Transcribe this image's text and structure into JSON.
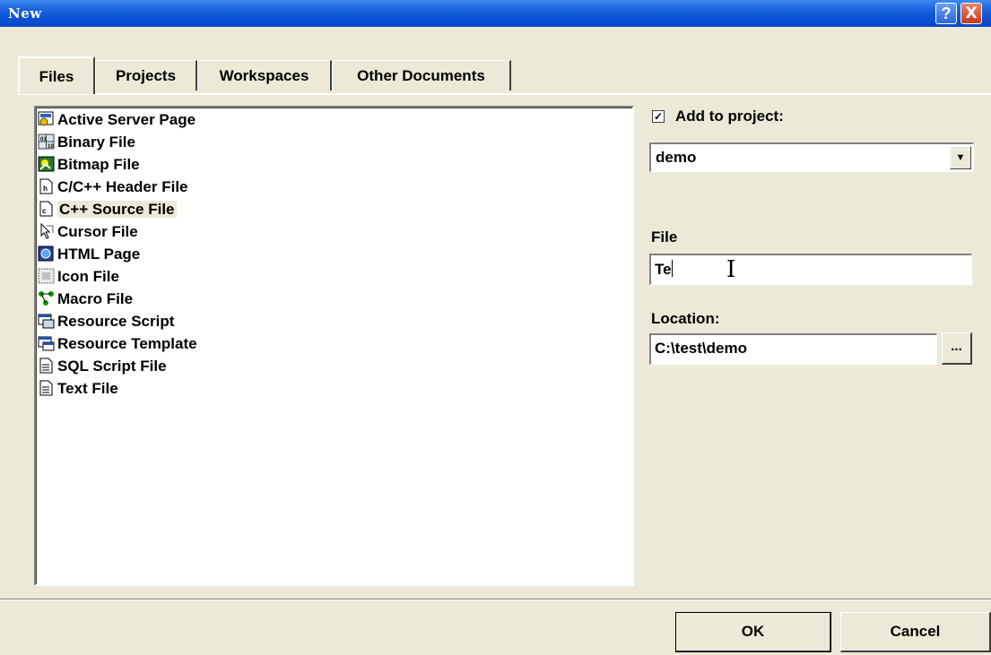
{
  "window": {
    "title": "New"
  },
  "title_buttons": {
    "help": "?",
    "close": "X"
  },
  "tabs": [
    {
      "label": "Files",
      "active": true
    },
    {
      "label": "Projects",
      "active": false
    },
    {
      "label": "Workspaces",
      "active": false
    },
    {
      "label": "Other Documents",
      "active": false
    }
  ],
  "file_types": [
    {
      "label": "Active Server Page",
      "icon": "asp-icon"
    },
    {
      "label": "Binary File",
      "icon": "binary-file-icon"
    },
    {
      "label": "Bitmap File",
      "icon": "bitmap-file-icon"
    },
    {
      "label": "C/C++ Header File",
      "icon": "header-file-icon"
    },
    {
      "label": "C++ Source File",
      "icon": "source-file-icon",
      "selected": true
    },
    {
      "label": "Cursor File",
      "icon": "cursor-file-icon"
    },
    {
      "label": "HTML Page",
      "icon": "html-page-icon"
    },
    {
      "label": "Icon File",
      "icon": "icon-file-icon"
    },
    {
      "label": "Macro File",
      "icon": "macro-file-icon"
    },
    {
      "label": "Resource Script",
      "icon": "resource-script-icon"
    },
    {
      "label": "Resource Template",
      "icon": "resource-template-icon"
    },
    {
      "label": "SQL Script File",
      "icon": "sql-script-icon"
    },
    {
      "label": "Text File",
      "icon": "text-file-icon"
    }
  ],
  "add_to_project": {
    "label": "Add to project:",
    "checked": true,
    "check_glyph": "✓"
  },
  "project_combo": {
    "value": "demo",
    "arrow": "▼"
  },
  "file_field": {
    "label": "File",
    "value": "Te"
  },
  "location_field": {
    "label": "Location:",
    "value": "C:\\test\\demo"
  },
  "browse_button": {
    "label": "..."
  },
  "buttons": {
    "ok": "OK",
    "cancel": "Cancel"
  },
  "colors": {
    "titlebar": "#0a55d8",
    "dialog_bg": "#ece9d8",
    "selected_item_bg": "#ece9d8"
  }
}
